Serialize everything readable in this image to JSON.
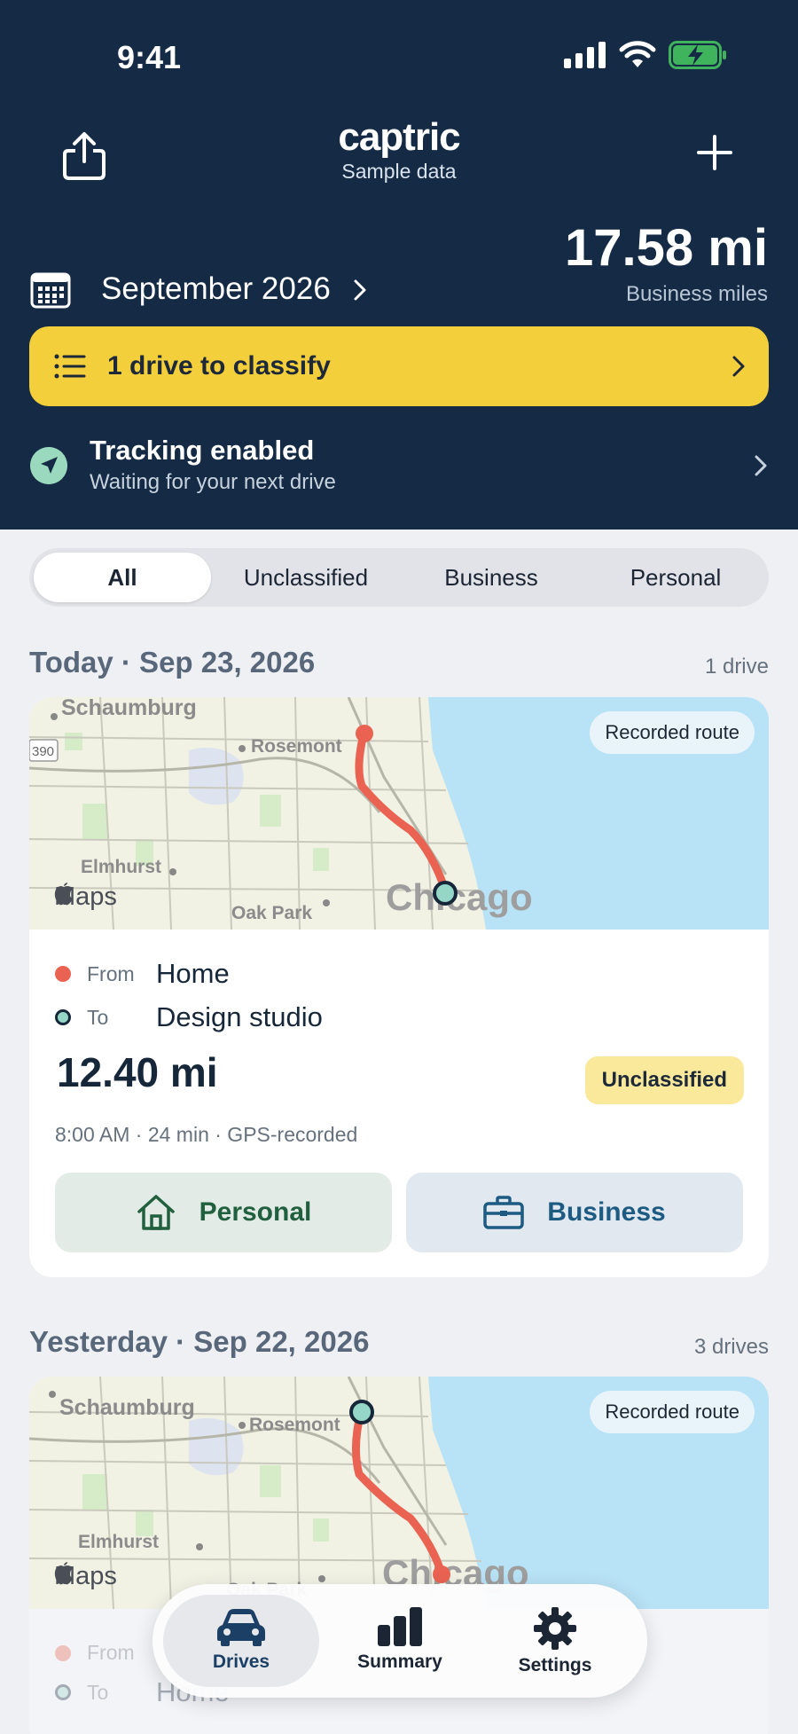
{
  "status_bar": {
    "time": "9:41"
  },
  "header": {
    "app_name": "captric",
    "subtitle": "Sample data",
    "business_miles_value": "17.58 mi",
    "business_miles_label": "Business miles",
    "month": "September 2026",
    "classify_banner": "1 drive to classify",
    "tracking_title": "Tracking enabled",
    "tracking_subtitle": "Waiting for your next drive",
    "colors": {
      "header_bg": "#152a44",
      "banner": "#f4cf3c",
      "tracking_icon": "#9bd9bf"
    }
  },
  "filter_tabs": [
    {
      "label": "All",
      "selected": true
    },
    {
      "label": "Unclassified",
      "selected": false
    },
    {
      "label": "Business",
      "selected": false
    },
    {
      "label": "Personal",
      "selected": false
    }
  ],
  "days": [
    {
      "title": "Today · Sep 23, 2026",
      "count": "1 drive",
      "drive": {
        "map_badge": "Recorded route",
        "map_labels": [
          "Schaumburg",
          "Rosemont",
          "Elmhurst",
          "Oak Park",
          "Chicago",
          "390"
        ],
        "maps_brand": "Maps",
        "from_label": "From",
        "from_value": "Home",
        "to_label": "To",
        "to_value": "Design studio",
        "distance": "12.40 mi",
        "status": "Unclassified",
        "meta": "8:00 AM · 24 min · GPS-recorded",
        "personal_button": "Personal",
        "business_button": "Business"
      }
    },
    {
      "title": "Yesterday · Sep 22, 2026",
      "count": "3 drives",
      "drive": {
        "map_badge": "Recorded route",
        "map_labels": [
          "Schaumburg",
          "Rosemont",
          "Elmhurst",
          "Oak Park",
          "Chicago"
        ],
        "maps_brand": "Maps",
        "from_label": "From",
        "to_label": "To",
        "to_value": "Home"
      }
    }
  ],
  "tab_bar": [
    {
      "label": "Drives",
      "icon": "car-icon",
      "selected": true
    },
    {
      "label": "Summary",
      "icon": "bar-chart-icon",
      "selected": false
    },
    {
      "label": "Settings",
      "icon": "gear-icon",
      "selected": false
    }
  ]
}
